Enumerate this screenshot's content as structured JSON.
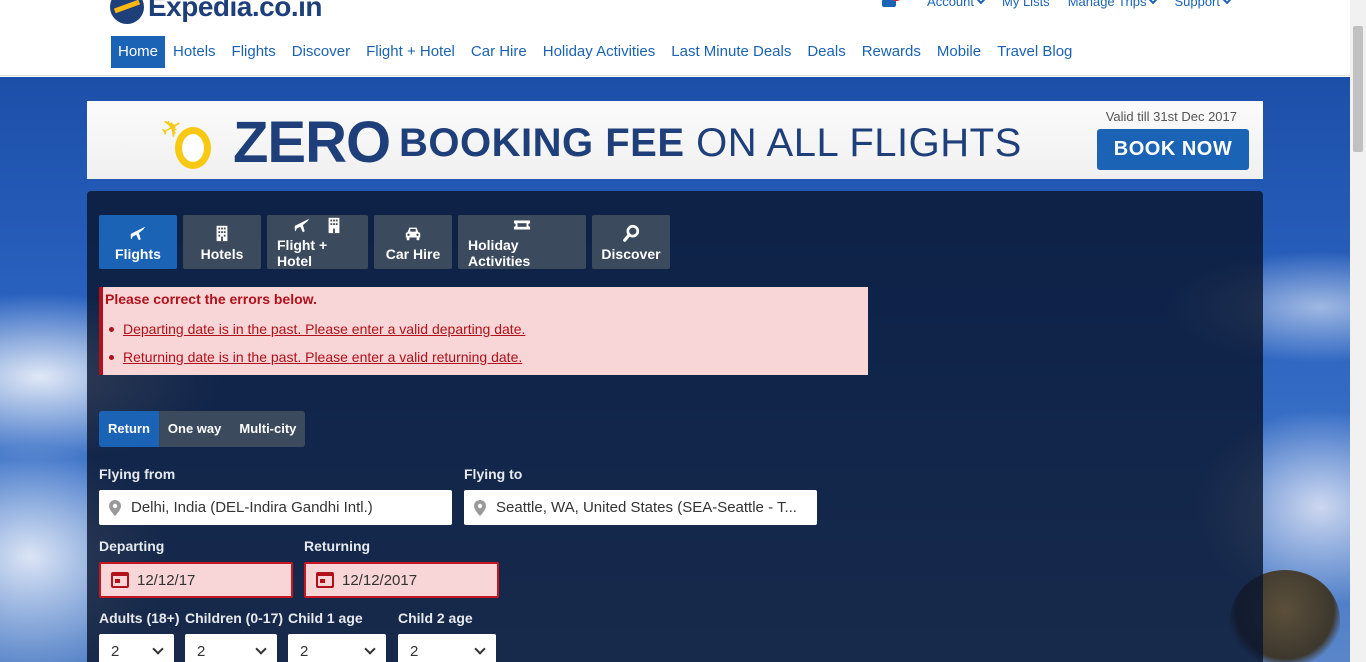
{
  "brand": {
    "name": "Expedia.co.in"
  },
  "top_links": [
    {
      "label": "Account"
    },
    {
      "label": "My Lists"
    },
    {
      "label": "Manage Trips"
    },
    {
      "label": "Support"
    }
  ],
  "nav": [
    "Home",
    "Hotels",
    "Flights",
    "Discover",
    "Flight + Hotel",
    "Car Hire",
    "Holiday Activities",
    "Last Minute Deals",
    "Deals",
    "Rewards",
    "Mobile",
    "Travel Blog"
  ],
  "banner": {
    "zero": "ZERO",
    "booking_fee": "BOOKING FEE",
    "on_all_flights": " ON ALL FLIGHTS",
    "valid": "Valid till 31st Dec 2017",
    "cta": "BOOK NOW"
  },
  "tabs": [
    "Flights",
    "Hotels",
    "Flight + Hotel",
    "Car Hire",
    "Holiday Activities",
    "Discover"
  ],
  "errors": {
    "title": "Please correct the errors below.",
    "items": [
      "Departing date is in the past. Please enter a valid departing date.",
      "Returning date is in the past. Please enter a valid returning date."
    ]
  },
  "trip_types": [
    "Return",
    "One way",
    "Multi-city"
  ],
  "form": {
    "flying_from_label": "Flying from",
    "flying_from_value": "Delhi, India (DEL-Indira Gandhi Intl.)",
    "flying_to_label": "Flying to",
    "flying_to_value": "Seattle, WA, United States (SEA-Seattle - T...",
    "departing_label": "Departing",
    "departing_value": "12/12/17",
    "returning_label": "Returning",
    "returning_value": "12/12/2017",
    "adults_label": "Adults (18+)",
    "adults_value": "2",
    "children_label": "Children (0-17)",
    "children_value": "2",
    "child1_label": "Child 1 age",
    "child1_value": "2",
    "child2_label": "Child 2 age",
    "child2_value": "2"
  },
  "colors": {
    "brand_blue": "#1b63b5",
    "error_red": "#b0111a",
    "error_bg": "#f8d5d6",
    "logo_navy": "#1e3f7a",
    "logo_yellow": "#fdb913"
  }
}
